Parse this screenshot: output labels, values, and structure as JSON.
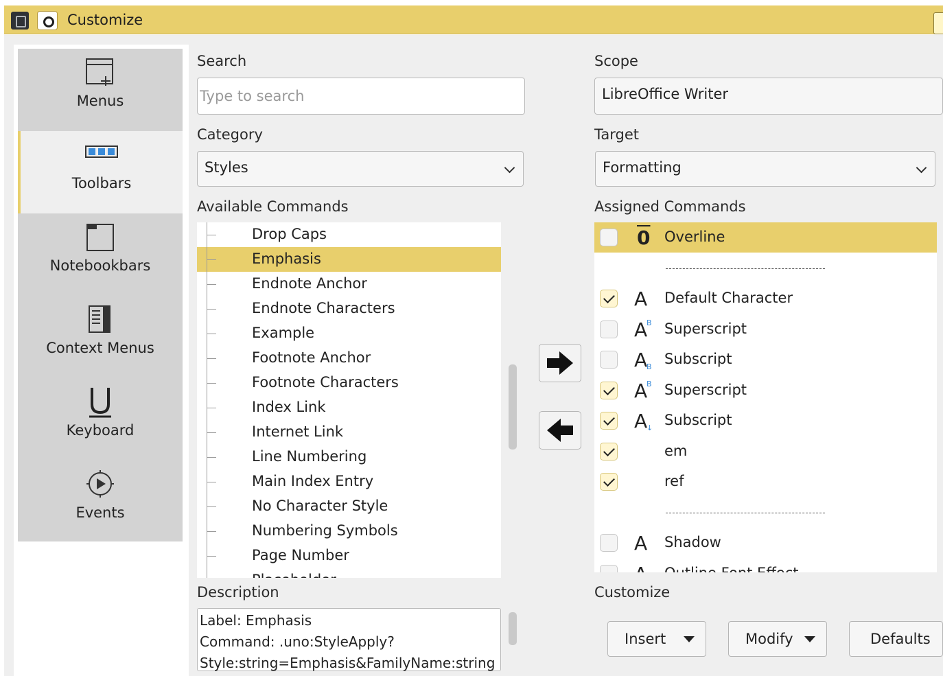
{
  "window": {
    "title": "Customize"
  },
  "sidebar": {
    "tabs": [
      {
        "label": "Menus",
        "icon": "menus-icon",
        "active": false
      },
      {
        "label": "Toolbars",
        "icon": "toolbars-icon",
        "active": true
      },
      {
        "label": "Notebookbars",
        "icon": "notebookbars-icon",
        "active": false
      },
      {
        "label": "Context Menus",
        "icon": "context-menus-icon",
        "active": false
      },
      {
        "label": "Keyboard",
        "icon": "keyboard-icon",
        "active": false
      },
      {
        "label": "Events",
        "icon": "events-icon",
        "active": false
      }
    ]
  },
  "search": {
    "label": "Search",
    "placeholder": "Type to search",
    "value": ""
  },
  "category": {
    "label": "Category",
    "selected": "Styles"
  },
  "available": {
    "label": "Available Commands",
    "items": [
      {
        "label": "Drop Caps",
        "selected": false
      },
      {
        "label": "Emphasis",
        "selected": true
      },
      {
        "label": "Endnote Anchor",
        "selected": false
      },
      {
        "label": "Endnote Characters",
        "selected": false
      },
      {
        "label": "Example",
        "selected": false
      },
      {
        "label": "Footnote Anchor",
        "selected": false
      },
      {
        "label": "Footnote Characters",
        "selected": false
      },
      {
        "label": "Index Link",
        "selected": false
      },
      {
        "label": "Internet Link",
        "selected": false
      },
      {
        "label": "Line Numbering",
        "selected": false
      },
      {
        "label": "Main Index Entry",
        "selected": false
      },
      {
        "label": "No Character Style",
        "selected": false
      },
      {
        "label": "Numbering Symbols",
        "selected": false
      },
      {
        "label": "Page Number",
        "selected": false
      },
      {
        "label": "Placeholder",
        "selected": false
      }
    ]
  },
  "scope": {
    "label": "Scope",
    "selected": "LibreOffice Writer"
  },
  "target": {
    "label": "Target",
    "selected": "Formatting"
  },
  "assigned": {
    "label": "Assigned Commands",
    "items": [
      {
        "label": "Overline",
        "checked": false,
        "icon": "overline-icon",
        "selected": true
      },
      {
        "label": "------------------------------------",
        "separator": true
      },
      {
        "label": "Default Character",
        "checked": true,
        "icon": "default-character-icon"
      },
      {
        "label": "Superscript",
        "checked": false,
        "icon": "superscript-icon"
      },
      {
        "label": "Subscript",
        "checked": false,
        "icon": "subscript-icon"
      },
      {
        "label": "Superscript",
        "checked": true,
        "icon": "superscript-icon"
      },
      {
        "label": "Subscript",
        "checked": true,
        "icon": "subscript-arrow-icon"
      },
      {
        "label": "em",
        "checked": true,
        "icon": ""
      },
      {
        "label": "ref",
        "checked": true,
        "icon": ""
      },
      {
        "label": "------------------------------------",
        "separator": true
      },
      {
        "label": "Shadow",
        "checked": false,
        "icon": "shadow-icon"
      },
      {
        "label": "Outline Font Effect",
        "checked": false,
        "icon": "outline-font-icon"
      }
    ]
  },
  "description": {
    "label": "Description",
    "lines": [
      "Label: Emphasis",
      "Command: .uno:StyleApply?",
      "Style:string=Emphasis&FamilyName:string"
    ]
  },
  "customize": {
    "label": "Customize",
    "insert_label": "Insert",
    "modify_label": "Modify",
    "defaults_label": "Defaults"
  },
  "colors": {
    "accent": "#e8cf6c",
    "panel": "#efefef",
    "sidebar": "#d3d3d3"
  }
}
